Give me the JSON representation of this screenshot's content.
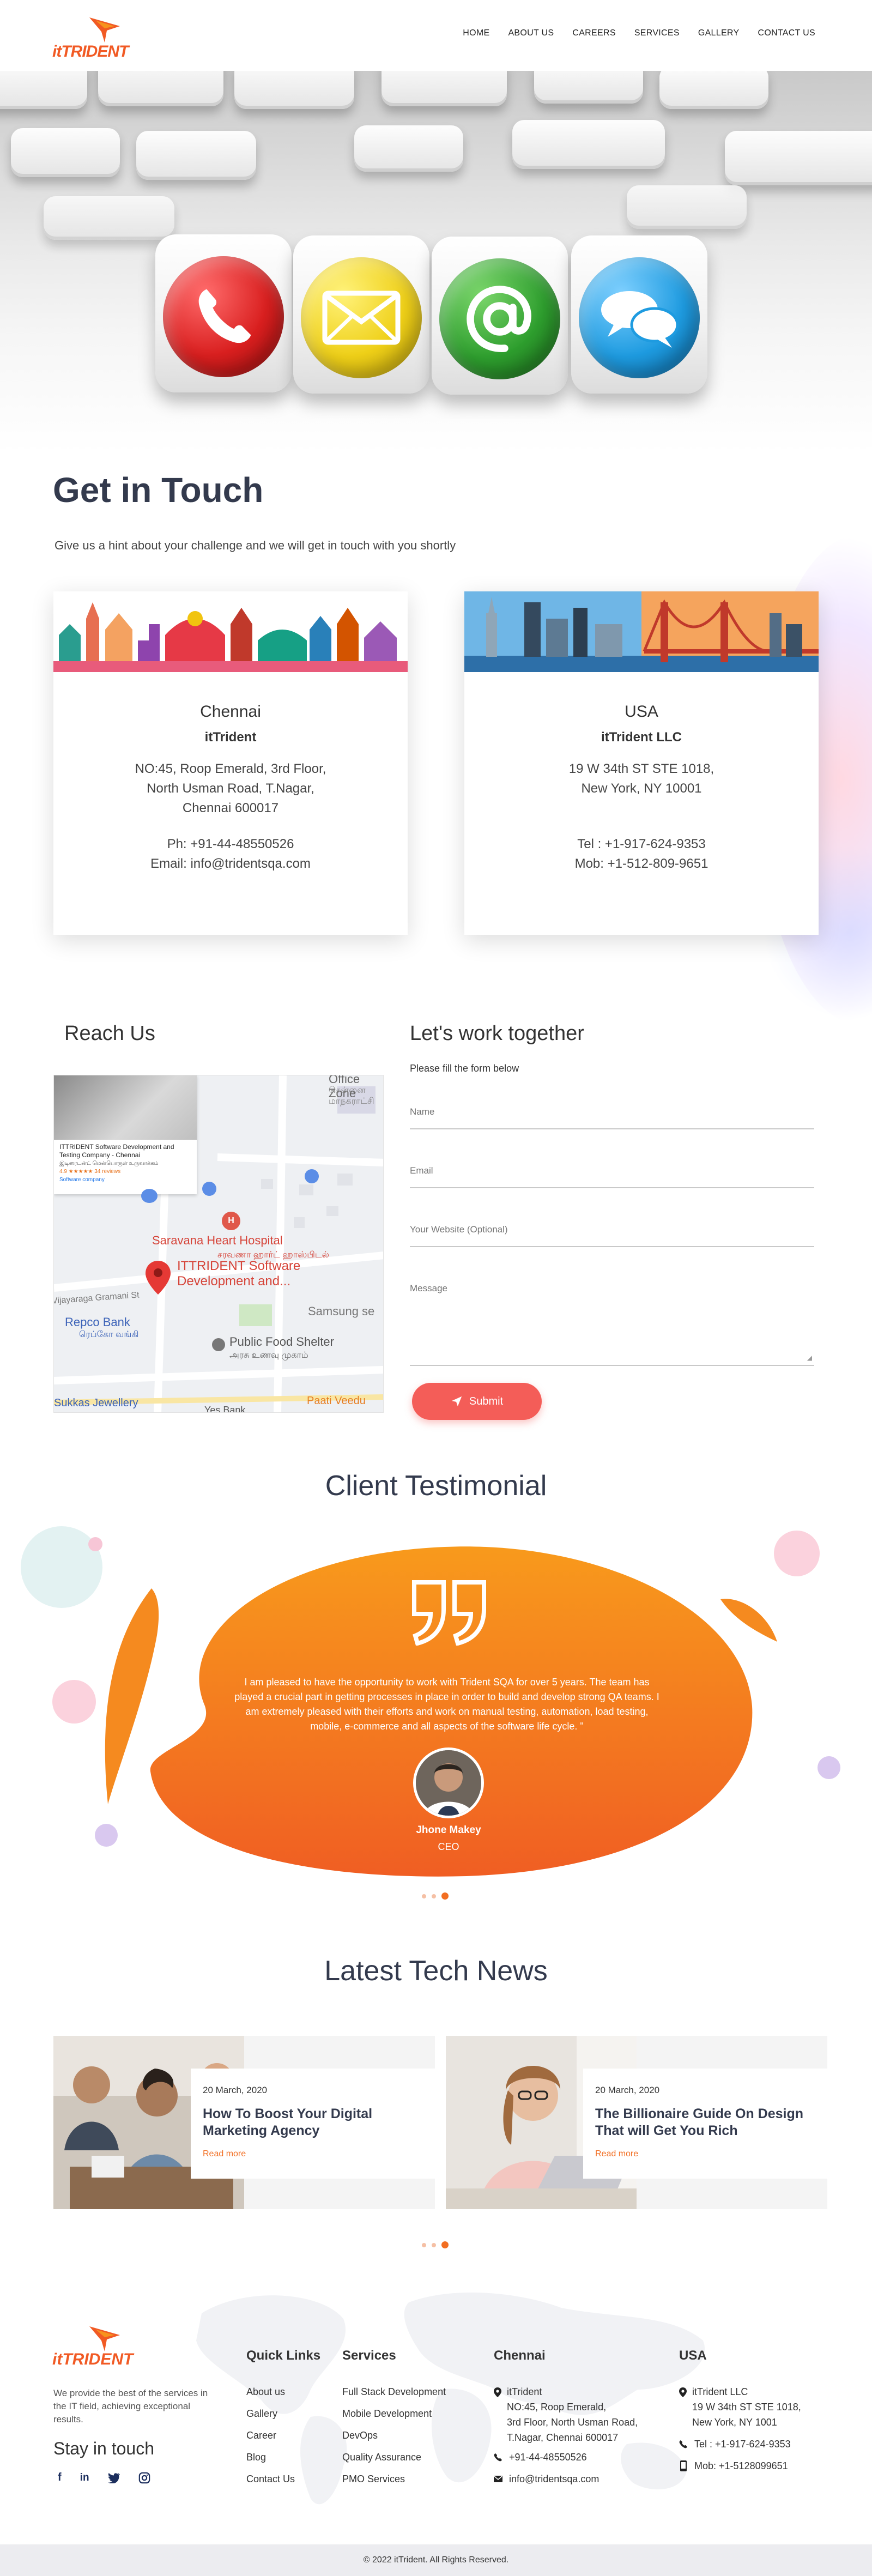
{
  "brand": {
    "name": "itTRIDENT",
    "accent": "#f26e22",
    "logo_color": "#f15a24"
  },
  "nav": [
    {
      "label": "HOME"
    },
    {
      "label": "ABOUT US"
    },
    {
      "label": "CAREERS"
    },
    {
      "label": "SERVICES"
    },
    {
      "label": "GALLERY"
    },
    {
      "label": "CONTACT US"
    }
  ],
  "hero": {
    "icons": [
      "phone-icon",
      "envelope-icon",
      "at-sign-icon",
      "speech-bubbles-icon"
    ],
    "cube_colors": [
      "#e02b2b",
      "#f2d416",
      "#2e9e2e",
      "#1e9be0"
    ]
  },
  "contact": {
    "title": "Get in Touch",
    "subtitle": "Give us a hint about your challenge and we will get in touch with you shortly"
  },
  "offices": [
    {
      "city": "Chennai",
      "company": "itTrident",
      "address": [
        "NO:45, Roop Emerald, 3rd Floor,",
        "North Usman Road, T.Nagar,",
        "Chennai 600017"
      ],
      "phone": "Ph: +91-44-48550526",
      "email": "Email: info@tridentsqa.com"
    },
    {
      "city": "USA",
      "company": "itTrident LLC",
      "address": [
        "19 W 34th ST STE 1018,",
        "New York, NY 10001"
      ],
      "phone": "Tel : +1-917-624-9353",
      "email": "Mob: +1-512-809-9651"
    }
  ],
  "reach": {
    "title": "Reach Us",
    "map": {
      "place_card_title": "ITTRIDENT Software Development and Testing Company - Chennai",
      "place_card_tamil": "இடிரைடன்ட் மென்பொருள் உருவாக்கம்",
      "place_card_rating": "4.9 ★★★★★ 34 reviews",
      "place_card_type": "Software company",
      "labels": {
        "zone": "Office Zone",
        "zone_tamil": "சென்னை மாநகராட்சி",
        "hospital": "Saravana Heart Hospital",
        "hospital_tamil": "சரவணா ஹார்ட் ஹாஸ்பிடல்",
        "pin": "ITTRIDENT Software Development and...",
        "road": "Vijayaraga Gramani St",
        "bank": "Repco Bank",
        "bank_tamil": "ரெப்கோ வங்கி",
        "food": "Public Food Shelter",
        "food_tamil": "அரசு உணவு முகாம்",
        "samsung": "Samsung se",
        "jewellery": "Sukkas Jewellery",
        "yes_bank": "Yes Bank",
        "paati": "Paati Veedu"
      }
    }
  },
  "form": {
    "title": "Let's work together",
    "subtitle": "Please fill the form below",
    "name_placeholder": "Name",
    "email_placeholder": "Email",
    "website_placeholder": "Your Website (Optional)",
    "message_placeholder": "Message",
    "submit_label": "Submit"
  },
  "testimonial": {
    "title": "Client Testimonial",
    "quote": "I am pleased to have the opportunity to work with Trident SQA for over 5 years. The team has played a crucial part in getting processes in place in order to build and develop strong QA teams. I am extremely pleased with their efforts and work on manual testing, automation, load testing, mobile, e-commerce and all aspects of the software life cycle. \"",
    "name": "Jhone Makey",
    "role": "CEO",
    "blob_colors": [
      "#f89a1c",
      "#f05e23"
    ]
  },
  "news": {
    "title": "Latest Tech News",
    "items": [
      {
        "date": "20 March, 2020",
        "title": "How To Boost Your Digital Marketing Agency",
        "more": "Read more"
      },
      {
        "date": "20 March, 2020",
        "title": "The Billionaire Guide On Design That will Get You Rich",
        "more": "Read more"
      }
    ]
  },
  "footer": {
    "about": "We provide the best of the services in the IT field, achieving exceptional results.",
    "stay_title": "Stay in touch",
    "social_icons": [
      "facebook-icon",
      "linkedin-icon",
      "twitter-icon",
      "instagram-icon"
    ],
    "quick_links_title": "Quick Links",
    "quick_links": [
      "About us",
      "Gallery",
      "Career",
      "Blog",
      "Contact Us"
    ],
    "services_title": "Services",
    "services": [
      "Full Stack Development",
      "Mobile Development",
      "DevOps",
      "Quality Assurance",
      "PMO Services"
    ],
    "chennai_title": "Chennai",
    "chennai_company": "itTrident",
    "chennai_address": [
      "NO:45, Roop Emerald,",
      "3rd Floor, North Usman Road,",
      "T.Nagar, Chennai 600017"
    ],
    "chennai_phone": "+91-44-48550526",
    "chennai_email": "info@tridentsqa.com",
    "usa_title": "USA",
    "usa_company": "itTrident LLC",
    "usa_address": [
      "19 W 34th ST STE 1018,",
      "New York, NY 1001"
    ],
    "usa_tel": "Tel : +1-917-624-9353",
    "usa_mob": "Mob: +1-5128099651",
    "copyright": "© 2022 itTrident. All Rights Reserved."
  }
}
